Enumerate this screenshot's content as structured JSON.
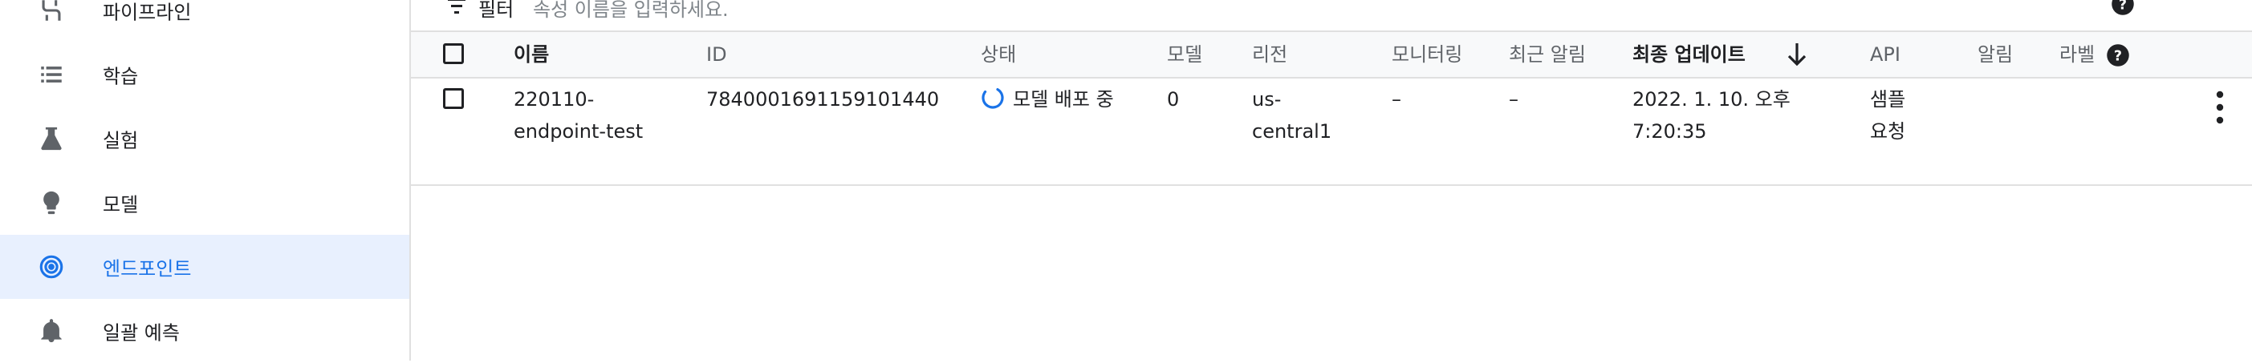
{
  "sidebar": {
    "items": [
      {
        "label": "파이프라인",
        "icon": "pipeline-icon",
        "active": false
      },
      {
        "label": "학습",
        "icon": "list-icon",
        "active": false
      },
      {
        "label": "실험",
        "icon": "flask-icon",
        "active": false
      },
      {
        "label": "모델",
        "icon": "lightbulb-icon",
        "active": false
      },
      {
        "label": "엔드포인트",
        "icon": "endpoint-icon",
        "active": true
      },
      {
        "label": "일괄 예측",
        "icon": "bell-icon",
        "active": false
      }
    ]
  },
  "filter": {
    "label": "필터",
    "placeholder": "속성 이름을 입력하세요."
  },
  "table": {
    "headers": {
      "name": "이름",
      "id": "ID",
      "status": "상태",
      "models": "모델",
      "region": "리전",
      "monitoring": "모니터링",
      "recent_alerts": "최근 알림",
      "last_updated": "최종 업데이트",
      "api": "API",
      "alerts": "알림",
      "labels": "라벨"
    },
    "rows": [
      {
        "name_line1": "220110-",
        "name_line2": "endpoint-test",
        "id": "7840001691159101440",
        "status": "모델 배포 중",
        "models": "0",
        "region_line1": "us-",
        "region_line2": "central1",
        "monitoring": "–",
        "recent_alerts": "–",
        "last_updated_line1": "2022. 1. 10. 오후",
        "last_updated_line2": "7:20:35",
        "api_line1": "샘플",
        "api_line2": "요청"
      }
    ]
  },
  "colors": {
    "accent": "#1a73e8",
    "active_bg": "#e8f0fe",
    "header_bg": "#f8f9fa",
    "border": "#e0e0e0",
    "text": "#202124",
    "muted_text": "#5f6368"
  }
}
